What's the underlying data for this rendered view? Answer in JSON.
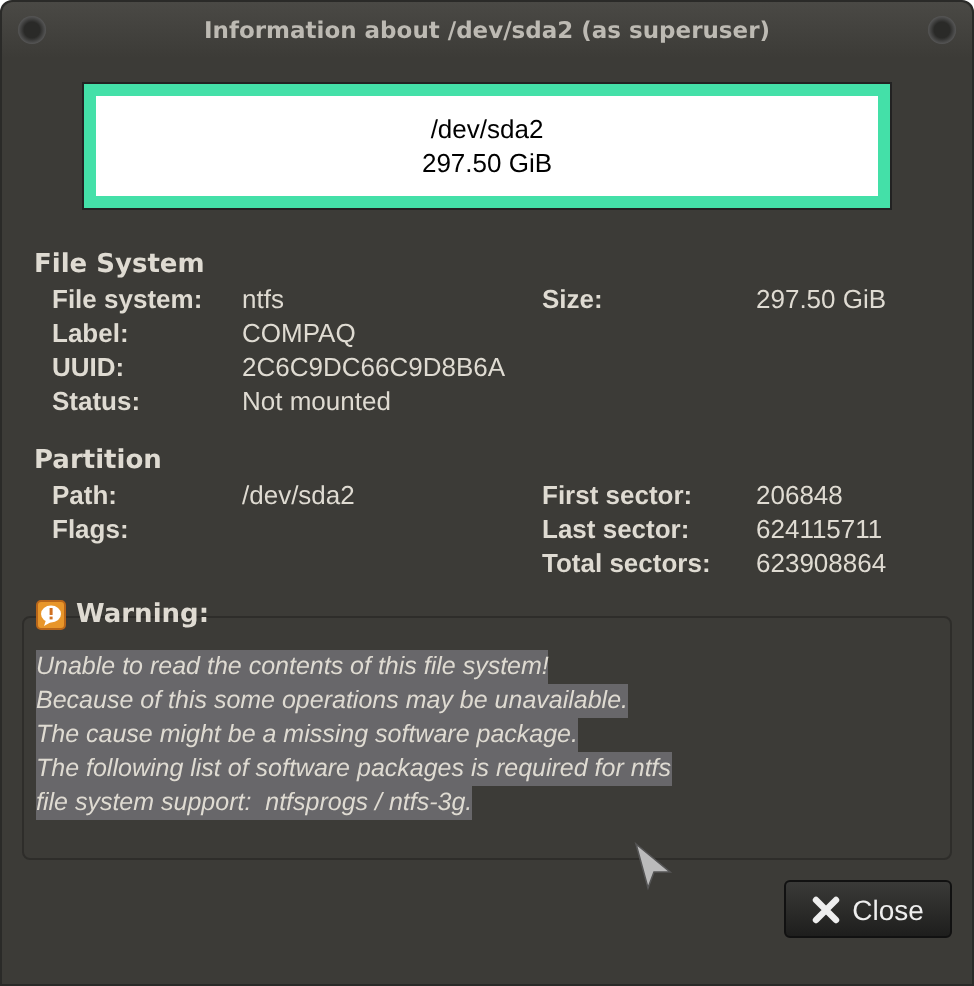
{
  "window": {
    "title": "Information about /dev/sda2 (as superuser)"
  },
  "partition_graphic": {
    "name": "/dev/sda2",
    "size": "297.50 GiB",
    "color": "#44e0a8"
  },
  "sections": [
    {
      "title": "File System",
      "left": [
        {
          "label": "File system:",
          "value": "ntfs"
        },
        {
          "label": "Label:",
          "value": "COMPAQ"
        },
        {
          "label": "UUID:",
          "value": "2C6C9DC66C9D8B6A"
        },
        {
          "label": "Status:",
          "value": "Not mounted"
        }
      ],
      "right": [
        {
          "label": "Size:",
          "value": "297.50 GiB"
        }
      ]
    },
    {
      "title": "Partition",
      "left": [
        {
          "label": "Path:",
          "value": "/dev/sda2"
        },
        {
          "label": "Flags:"
        }
      ],
      "right": [
        {
          "label": "First sector:",
          "value": "206848"
        },
        {
          "label": "Last sector:",
          "value": "624115711"
        },
        {
          "label": "Total sectors:",
          "value": "623908864"
        }
      ]
    }
  ],
  "warning": {
    "title": "Warning:",
    "text_selected": true,
    "lines": [
      "Unable to read the contents of this file system!",
      "Because of this some operations may be unavailable.",
      "The cause might be a missing software package.",
      "The following list of software packages is required for ntfs",
      "file system support:  ntfsprogs / ntfs-3g."
    ]
  },
  "buttons": [
    {
      "label": "Close"
    }
  ]
}
